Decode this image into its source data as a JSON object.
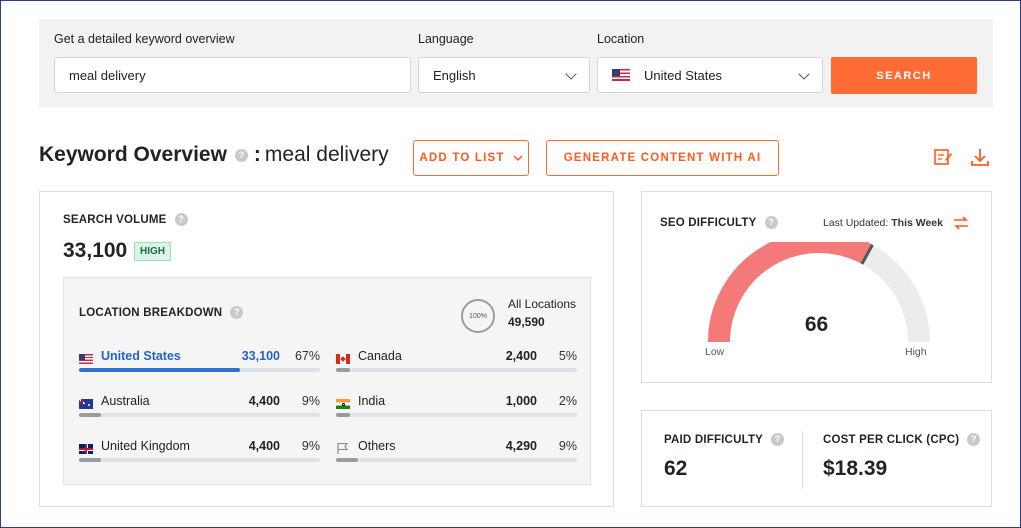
{
  "search": {
    "keyword_label": "Get a detailed keyword overview",
    "keyword_value": "meal delivery",
    "language_label": "Language",
    "language_value": "English",
    "location_label": "Location",
    "location_value": "United States",
    "search_button": "SEARCH"
  },
  "header": {
    "title": "Keyword Overview",
    "separator": ":",
    "keyword": "meal delivery",
    "add_to_list": "ADD TO LIST",
    "generate": "GENERATE CONTENT WITH AI"
  },
  "volume": {
    "caption": "SEARCH VOLUME",
    "value": "33,100",
    "badge": "HIGH"
  },
  "breakdown": {
    "caption": "LOCATION BREAKDOWN",
    "ring_label": "100%",
    "all_label": "All Locations",
    "all_value": "49,590",
    "rows": [
      {
        "name": "United States",
        "value": "33,100",
        "pct": "67%",
        "share": 0.67
      },
      {
        "name": "Canada",
        "value": "2,400",
        "pct": "5%",
        "share": 0.05
      },
      {
        "name": "Australia",
        "value": "4,400",
        "pct": "9%",
        "share": 0.09
      },
      {
        "name": "India",
        "value": "1,000",
        "pct": "2%",
        "share": 0.02
      },
      {
        "name": "United Kingdom",
        "value": "4,400",
        "pct": "9%",
        "share": 0.09
      },
      {
        "name": "Others",
        "value": "4,290",
        "pct": "9%",
        "share": 0.09
      }
    ]
  },
  "seo": {
    "caption": "SEO DIFFICULTY",
    "updated_label": "Last Updated:",
    "updated_value": "This Week",
    "value": "66",
    "score": 66,
    "low": "Low",
    "high": "High"
  },
  "paid": {
    "caption": "PAID DIFFICULTY",
    "value": "62"
  },
  "cpc": {
    "caption": "COST PER CLICK (CPC)",
    "value": "$18.39"
  },
  "colors": {
    "accent": "#ff6b35",
    "gauge_fill": "#f47a7a",
    "gauge_track": "#ececee",
    "active_bar": "#2f6fd8"
  }
}
